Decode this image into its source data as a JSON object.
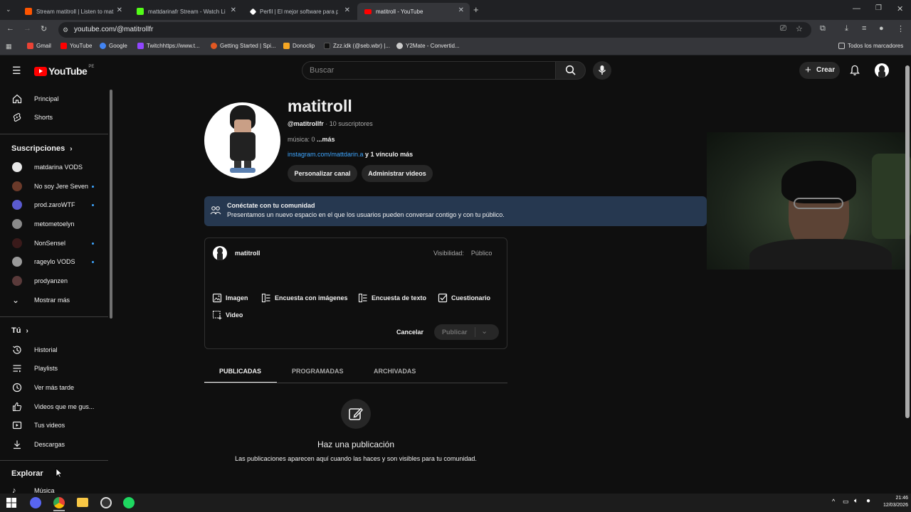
{
  "browser": {
    "tabs": [
      {
        "title": "Stream matitroll | Listen to mat",
        "color": "#ff5500"
      },
      {
        "title": "mattdarinafr Stream - Watch Li",
        "color": "#53fc18"
      },
      {
        "title": "Perfil | El mejor software para p",
        "color": "#ffffff"
      },
      {
        "title": "matitroll - YouTube",
        "color": "#ff0000"
      }
    ],
    "url": "youtube.com/@matitrollfr",
    "bookmarks": [
      "Gmail",
      "YouTube",
      "Google",
      "Twitchhttps://www.t...",
      "Getting Started | Spi...",
      "Donoclip",
      "Zzz.idk (@seb.wbr) |...",
      "Y2Mate - Convertid..."
    ],
    "bookmarks_all": "Todos los marcadores"
  },
  "header": {
    "logo": "YouTube",
    "country": "PE",
    "search_placeholder": "Buscar",
    "create_label": "Crear"
  },
  "sidebar": {
    "main": [
      {
        "label": "Principal",
        "icon": "home-icon"
      },
      {
        "label": "Shorts",
        "icon": "shorts-icon"
      }
    ],
    "subscriptions_title": "Suscripciones",
    "subscriptions": [
      {
        "label": "matdarina VODS",
        "dot": false,
        "color": "#e8e8e8"
      },
      {
        "label": "No soy Jere Seven",
        "dot": true,
        "color": "#6b3a2a"
      },
      {
        "label": "prod.zaroWTF",
        "dot": true,
        "color": "#5a5ad0"
      },
      {
        "label": "metometoelyn",
        "dot": false,
        "color": "#8a8a8a"
      },
      {
        "label": "NonSensel",
        "dot": true,
        "color": "#3a1a1a"
      },
      {
        "label": "rageylo VODS",
        "dot": true,
        "color": "#9a9a9a"
      },
      {
        "label": "prodyanzen",
        "dot": false,
        "color": "#5a3a3a"
      }
    ],
    "show_more": "Mostrar más",
    "you_title": "Tú",
    "you_items": [
      {
        "label": "Historial",
        "icon": "history-icon"
      },
      {
        "label": "Playlists",
        "icon": "playlists-icon"
      },
      {
        "label": "Ver más tarde",
        "icon": "watch-later-icon"
      },
      {
        "label": "Videos que me gus...",
        "icon": "liked-icon"
      },
      {
        "label": "Tus videos",
        "icon": "your-videos-icon"
      },
      {
        "label": "Descargas",
        "icon": "downloads-icon"
      }
    ],
    "explore_title": "Explorar",
    "explore_items": [
      {
        "label": "Música",
        "icon": "music-icon"
      }
    ]
  },
  "channel": {
    "name": "matitroll",
    "handle": "@matitrollfr",
    "subscribers": " · 10 suscriptores",
    "description": "música: 0",
    "more": "...más",
    "link": "instagram.com/mattdarin.a",
    "link_more": " y 1 vínculo más",
    "customize_button": "Personalizar canal",
    "manage_button": "Administrar videos"
  },
  "banner": {
    "title": "Conéctate con tu comunidad",
    "body": "Presentamos un nuevo espacio en el que los usuarios pueden conversar contigo y con tu público."
  },
  "composer": {
    "author": "matitroll",
    "visibility_label": "Visibilidad:",
    "visibility_value": "Público",
    "options": [
      "Imagen",
      "Encuesta con imágenes",
      "Encuesta de texto",
      "Cuestionario",
      "Video"
    ],
    "cancel": "Cancelar",
    "publish": "Publicar"
  },
  "post_tabs": [
    "PUBLICADAS",
    "PROGRAMADAS",
    "ARCHIVADAS"
  ],
  "empty_state": {
    "title": "Haz una publicación",
    "body": "Las publicaciones aparecen aquí cuando las haces y son visibles para tu comunidad."
  },
  "taskbar": {
    "time": "21:46",
    "date": "12/03/2026"
  }
}
